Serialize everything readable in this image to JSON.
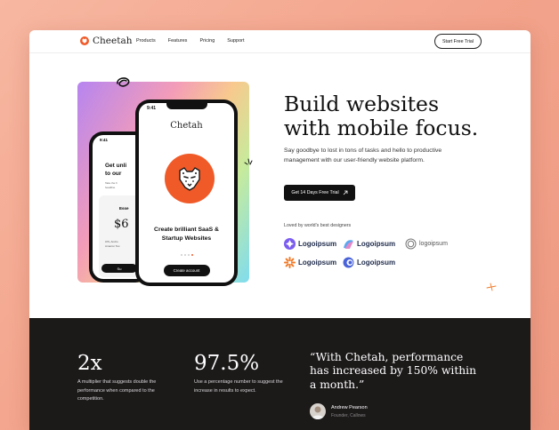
{
  "nav": {
    "brand": "Cheetah",
    "menu": [
      "Products",
      "Features",
      "Pricing",
      "Support"
    ],
    "cta": "Start Free Trial"
  },
  "phone_front": {
    "time": "9:41",
    "app_title": "Chetah",
    "headline_line1": "Create brilliant SaaS &",
    "headline_line2": "Startup Websites",
    "button": "Create account"
  },
  "phone_back": {
    "time": "9:41",
    "headline_line1": "Get unli",
    "headline_line2": "to our",
    "small_line1": "Take the fi",
    "small_line2": "headline",
    "tier": "Esse",
    "price": "$6",
    "feature1": "iOS, Andro",
    "feature2": "Amazon Tes",
    "button": "Su"
  },
  "hero": {
    "title_line1": "Build websites",
    "title_line2": "with mobile focus.",
    "subtitle": "Say goodbye to lost in tons of tasks and hello to productive management with our user-friendly website platform.",
    "cta": "Get 14 Days Free Trial",
    "loved_by": "Loved by world's best designers",
    "logos": [
      "Logoipsum",
      "Logoipsum",
      "logoipsum",
      "Logoipsum",
      "Logoipsum"
    ]
  },
  "stats": [
    {
      "value": "2x",
      "description": "A multiplier that suggests double the performance when compared to the competition."
    },
    {
      "value": "97.5%",
      "description": "Use a percentage number to suggest the increase in results to expect."
    }
  ],
  "testimonial": {
    "quote": "“With Chetah, performance has increased by 150% within a month.”",
    "author": "Andrew Pearson",
    "role": "Founder, Callows"
  },
  "colors": {
    "accent": "#f05a28",
    "dark": "#1c1919",
    "background": "#f3a38b"
  }
}
